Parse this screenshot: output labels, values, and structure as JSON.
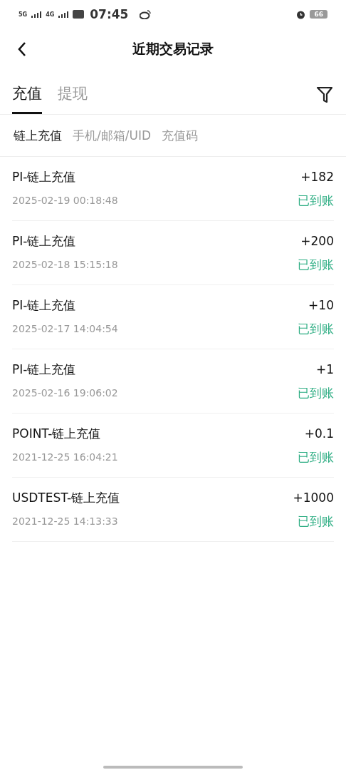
{
  "status_bar": {
    "signal_1": "5G",
    "signal_2": "4G",
    "time": "07:45",
    "battery": "66"
  },
  "header": {
    "title": "近期交易记录"
  },
  "tabs": [
    {
      "label": "充值",
      "selected": true
    },
    {
      "label": "提现",
      "selected": false
    }
  ],
  "sub_tabs": [
    {
      "label": "链上充值",
      "selected": true
    },
    {
      "label": "手机/邮箱/UID",
      "selected": false
    },
    {
      "label": "充值码",
      "selected": false
    }
  ],
  "records": [
    {
      "title": "PI-链上充值",
      "amount": "+182",
      "time": "2025-02-19 00:18:48",
      "status": "已到账"
    },
    {
      "title": "PI-链上充值",
      "amount": "+200",
      "time": "2025-02-18 15:15:18",
      "status": "已到账"
    },
    {
      "title": "PI-链上充值",
      "amount": "+10",
      "time": "2025-02-17 14:04:54",
      "status": "已到账"
    },
    {
      "title": "PI-链上充值",
      "amount": "+1",
      "time": "2025-02-16 19:06:02",
      "status": "已到账"
    },
    {
      "title": "POINT-链上充值",
      "amount": "+0.1",
      "time": "2021-12-25 16:04:21",
      "status": "已到账"
    },
    {
      "title": "USDTEST-链上充值",
      "amount": "+1000",
      "time": "2021-12-25 14:13:33",
      "status": "已到账"
    }
  ]
}
